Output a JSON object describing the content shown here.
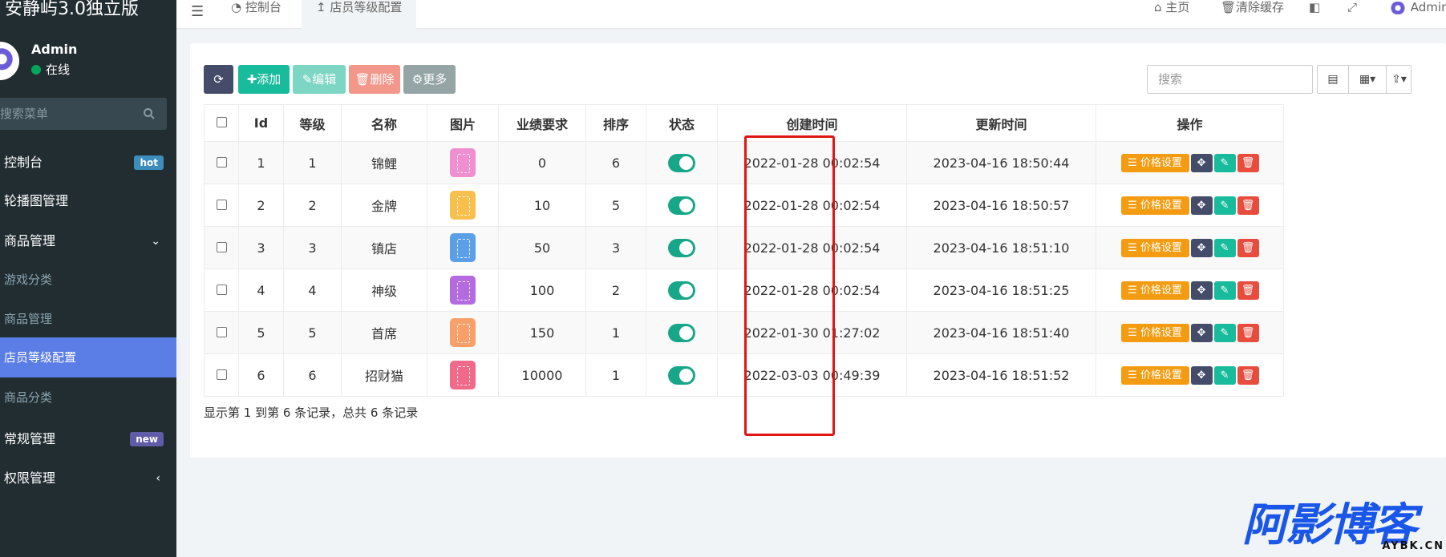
{
  "app": {
    "brand": "安静屿3.0独立版"
  },
  "user": {
    "name": "Admin",
    "status": "在线"
  },
  "sidebar": {
    "search_placeholder": "搜索菜单",
    "items": [
      {
        "label": "控制台",
        "badge": "hot"
      },
      {
        "label": "轮播图管理"
      },
      {
        "label": "商品管理",
        "chevron": "⌄"
      },
      {
        "label": "游戏分类"
      },
      {
        "label": "商品管理"
      },
      {
        "label": "店员等级配置"
      },
      {
        "label": "商品分类"
      },
      {
        "label": "常规管理",
        "badge": "new"
      },
      {
        "label": "权限管理",
        "chevron": "‹"
      }
    ]
  },
  "topbar": {
    "tabs": [
      {
        "label": "控制台",
        "icon": "dashboard-icon"
      },
      {
        "label": "店员等级配置",
        "icon": "sort-icon"
      }
    ],
    "right": {
      "home": "主页",
      "clear_cache": "清除缓存",
      "user": "Admin"
    }
  },
  "toolbar": {
    "add": "添加",
    "edit": "编辑",
    "delete": "删除",
    "more": "更多"
  },
  "search": {
    "placeholder": "搜索"
  },
  "table": {
    "headers": [
      "Id",
      "等级",
      "名称",
      "图片",
      "业绩要求",
      "排序",
      "状态",
      "创建时间",
      "更新时间",
      "操作"
    ],
    "rows": [
      {
        "id": "1",
        "level": "1",
        "name": "锦鲤",
        "thumb_color": "#ef8fd0",
        "requirement": "0",
        "sort": "6",
        "status": true,
        "created": "2022-01-28 00:02:54",
        "updated": "2023-04-16 18:50:44"
      },
      {
        "id": "2",
        "level": "2",
        "name": "金牌",
        "thumb_color": "#f7c04d",
        "requirement": "10",
        "sort": "5",
        "status": true,
        "created": "2022-01-28 00:02:54",
        "updated": "2023-04-16 18:50:57"
      },
      {
        "id": "3",
        "level": "3",
        "name": "镇店",
        "thumb_color": "#5b9fe6",
        "requirement": "50",
        "sort": "3",
        "status": true,
        "created": "2022-01-28 00:02:54",
        "updated": "2023-04-16 18:51:10"
      },
      {
        "id": "4",
        "level": "4",
        "name": "神级",
        "thumb_color": "#b46be0",
        "requirement": "100",
        "sort": "2",
        "status": true,
        "created": "2022-01-28 00:02:54",
        "updated": "2023-04-16 18:51:25"
      },
      {
        "id": "5",
        "level": "5",
        "name": "首席",
        "thumb_color": "#f7a06a",
        "requirement": "150",
        "sort": "1",
        "status": true,
        "created": "2022-01-30 01:27:02",
        "updated": "2023-04-16 18:51:40"
      },
      {
        "id": "6",
        "level": "6",
        "name": "招财猫",
        "thumb_color": "#f06a8a",
        "requirement": "10000",
        "sort": "1",
        "status": true,
        "created": "2022-03-03 00:49:39",
        "updated": "2023-04-16 18:51:52"
      }
    ],
    "action_price": "价格设置"
  },
  "pagination": {
    "summary": "显示第 1 到第 6 条记录，总共 6 条记录"
  },
  "watermark": {
    "main": "阿影博客",
    "sub": "AYBK.CN"
  },
  "colors": {
    "sidebar_bg": "#222d32",
    "active_menu": "#5b7de6",
    "primary": "#18bc9c",
    "warning": "#f39c12",
    "danger": "#e74c3c",
    "highlight": "#e01515"
  }
}
